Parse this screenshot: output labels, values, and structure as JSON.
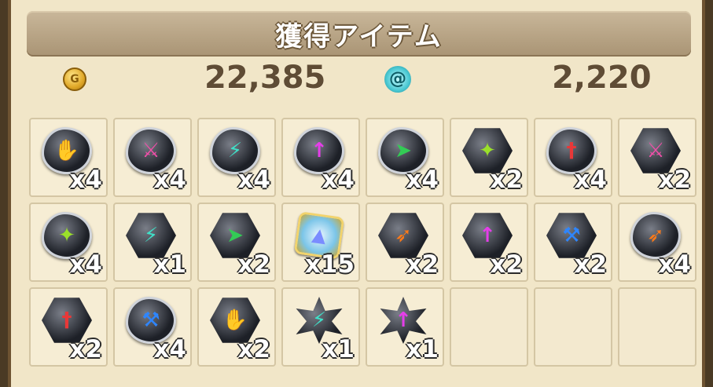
{
  "title": "獲得アイテム",
  "currency": {
    "gold": {
      "icon": "gold-coin-icon",
      "glyph": "G",
      "value": "22,385"
    },
    "rune": {
      "icon": "rune-swirl-icon",
      "glyph": "@",
      "value": "2,220"
    }
  },
  "items": [
    {
      "icon": "yellow-glove-icon",
      "shape": "blob",
      "color": "#f5cf1a",
      "glyph": "✋",
      "count": "x4"
    },
    {
      "icon": "pink-claw-icon",
      "shape": "blob",
      "color": "#ee4fa8",
      "glyph": "⚔",
      "count": "x4"
    },
    {
      "icon": "teal-lightning-icon",
      "shape": "blob",
      "color": "#3fe0c8",
      "glyph": "⚡",
      "count": "x4"
    },
    {
      "icon": "magenta-staff-icon",
      "shape": "blob",
      "color": "#e43ee8",
      "glyph": "↑",
      "count": "x4"
    },
    {
      "icon": "green-arrow-icon",
      "shape": "blob",
      "color": "#33cc55",
      "glyph": "➤",
      "count": "x4"
    },
    {
      "icon": "lime-claw-icon",
      "shape": "hex",
      "color": "#9be02a",
      "glyph": "✦",
      "count": "x2"
    },
    {
      "icon": "red-sword-icon",
      "shape": "blob",
      "color": "#e83838",
      "glyph": "†",
      "count": "x4"
    },
    {
      "icon": "pink-claw-icon",
      "shape": "hex",
      "color": "#ee4fa8",
      "glyph": "⚔",
      "count": "x2"
    },
    {
      "icon": "lime-claw-icon",
      "shape": "blob",
      "color": "#9be02a",
      "glyph": "✦",
      "count": "x4"
    },
    {
      "icon": "teal-lightning-icon",
      "shape": "hex",
      "color": "#3fe0c8",
      "glyph": "⚡",
      "count": "x1"
    },
    {
      "icon": "green-arrow-icon",
      "shape": "hex",
      "color": "#33cc55",
      "glyph": "➤",
      "count": "x2"
    },
    {
      "icon": "crystal-gem-icon",
      "shape": "gem",
      "color": "#7a8cff",
      "glyph": "▲",
      "count": "x15"
    },
    {
      "icon": "orange-bow-icon",
      "shape": "hex",
      "color": "#ff7a18",
      "glyph": "➶",
      "count": "x2"
    },
    {
      "icon": "magenta-staff-icon",
      "shape": "hex",
      "color": "#e43ee8",
      "glyph": "↑",
      "count": "x2"
    },
    {
      "icon": "blue-axe-icon",
      "shape": "hex",
      "color": "#2e86ff",
      "glyph": "⚒",
      "count": "x2"
    },
    {
      "icon": "orange-bow-icon",
      "shape": "blob",
      "color": "#ff7a18",
      "glyph": "➶",
      "count": "x4"
    },
    {
      "icon": "red-sword-icon",
      "shape": "hex",
      "color": "#e83838",
      "glyph": "†",
      "count": "x2"
    },
    {
      "icon": "blue-axe-icon",
      "shape": "blob",
      "color": "#2e86ff",
      "glyph": "⚒",
      "count": "x4"
    },
    {
      "icon": "yellow-glove-icon",
      "shape": "hex",
      "color": "#f5cf1a",
      "glyph": "✋",
      "count": "x2"
    },
    {
      "icon": "teal-lightning-icon",
      "shape": "star",
      "color": "#3fe0c8",
      "glyph": "⚡",
      "count": "x1"
    },
    {
      "icon": "magenta-staff-icon",
      "shape": "star",
      "color": "#e43ee8",
      "glyph": "↑",
      "count": "x1"
    },
    {
      "icon": "",
      "shape": "empty",
      "color": "",
      "glyph": "",
      "count": ""
    },
    {
      "icon": "",
      "shape": "empty",
      "color": "",
      "glyph": "",
      "count": ""
    },
    {
      "icon": "",
      "shape": "empty",
      "color": "",
      "glyph": "",
      "count": ""
    }
  ]
}
